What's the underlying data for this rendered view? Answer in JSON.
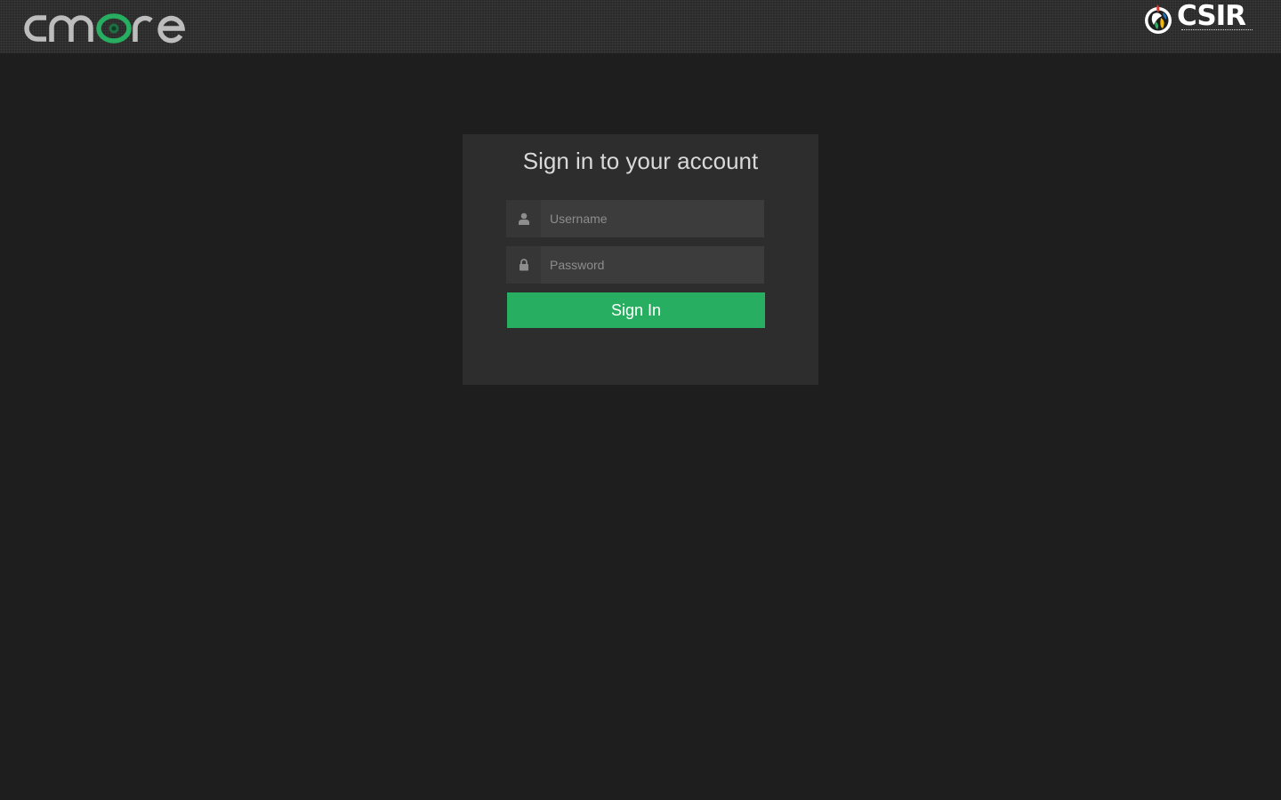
{
  "header": {
    "brand_logo": {
      "icon": "cmore-logo",
      "text": "cmore",
      "accent": "#27ae60",
      "color": "#bdbdbd"
    },
    "partner_logo": {
      "icon": "csir-logo",
      "text": "CSIR"
    }
  },
  "login": {
    "title": "Sign in to your account",
    "username": {
      "placeholder": "Username",
      "value": "",
      "icon": "user-icon"
    },
    "password": {
      "placeholder": "Password",
      "value": "",
      "icon": "lock-icon"
    },
    "submit_label": "Sign In"
  },
  "colors": {
    "background": "#1e1e1e",
    "panel": "#2d2d2d",
    "input": "#3c3c3c",
    "primary_button": "#27ae60"
  }
}
